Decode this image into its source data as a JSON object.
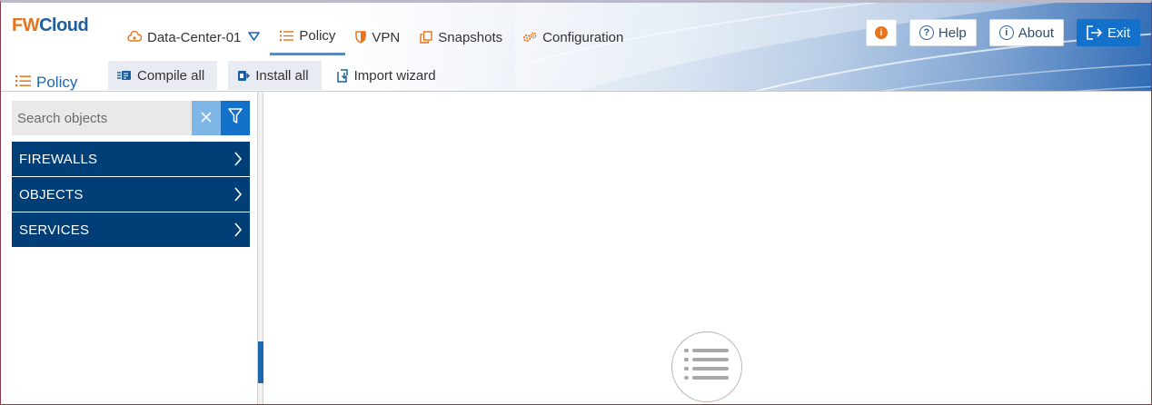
{
  "app": {
    "logo_fw": "FW",
    "logo_cloud": "Cloud"
  },
  "nav": {
    "datacenter": {
      "label": "Data-Center-01",
      "icon": "cloud-cog-icon"
    },
    "items": [
      {
        "label": "Policy",
        "icon": "list-icon",
        "active": true
      },
      {
        "label": "VPN",
        "icon": "shield-icon"
      },
      {
        "label": "Snapshots",
        "icon": "copy-icon"
      },
      {
        "label": "Configuration",
        "icon": "cogs-icon"
      }
    ]
  },
  "header_buttons": {
    "help": "Help",
    "about": "About",
    "exit": "Exit"
  },
  "page": {
    "title": "Policy"
  },
  "toolbar": {
    "compile_all": "Compile all",
    "install_all": "Install all",
    "import_wizard": "Import wizard"
  },
  "sidebar": {
    "search_placeholder": "Search objects",
    "items": [
      {
        "label": "FIREWALLS"
      },
      {
        "label": "OBJECTS"
      },
      {
        "label": "SERVICES"
      }
    ]
  },
  "colors": {
    "accent_orange": "#e8731a",
    "brand_blue": "#1d5f9e",
    "tree_bg": "#003e77",
    "primary_button": "#1471c9"
  }
}
